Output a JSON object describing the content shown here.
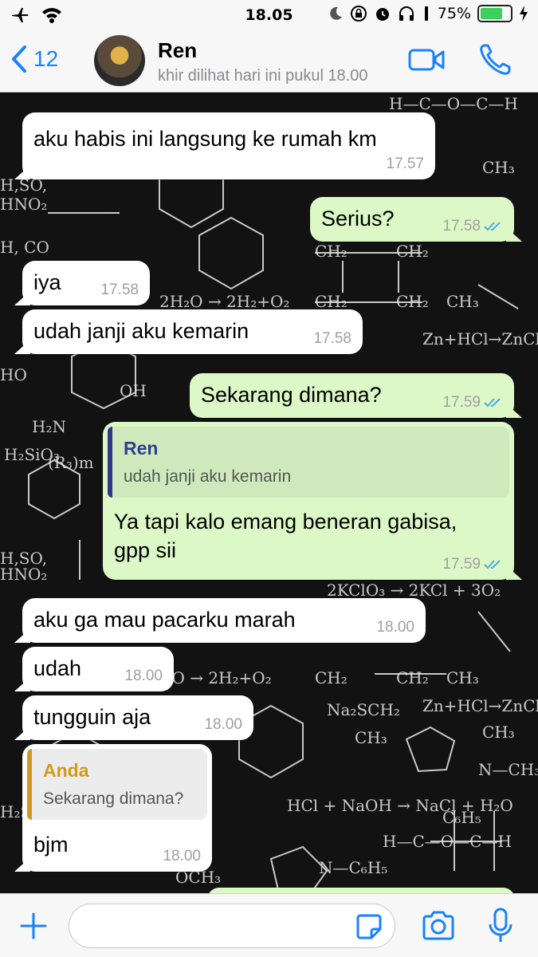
{
  "status_bar": {
    "time": "18.05",
    "battery_percent": "75%",
    "battery_level": 0.75
  },
  "header": {
    "back_count": "12",
    "contact_name": "Ren",
    "contact_status": "khir dilihat hari ini pukul 18.00"
  },
  "messages": [
    {
      "text": "aku habis ini langsung ke rumah km",
      "time": "17.57"
    },
    {
      "text": "Serius?",
      "time": "17.58"
    },
    {
      "text": "iya",
      "time": "17.58"
    },
    {
      "text": "udah janji aku kemarin",
      "time": "17.58"
    },
    {
      "text": "Sekarang dimana?",
      "time": "17.59"
    },
    {
      "quote_name": "Ren",
      "quote_text": "udah janji aku kemarin",
      "text_line1": "Ya tapi kalo emang beneran gabisa,",
      "text_line2": "gpp sii",
      "time": "17.59"
    },
    {
      "text": "aku ga mau pacarku marah",
      "time": "18.00"
    },
    {
      "text": "udah",
      "time": "18.00"
    },
    {
      "text": "tungguin aja",
      "time": "18.00"
    },
    {
      "quote_name": "Anda",
      "quote_text": "Sekarang dimana?",
      "text": "bjm",
      "time": "18.00"
    }
  ],
  "colors": {
    "accent": "#1a82fb",
    "outgoing_bubble": "#dcf8c6",
    "incoming_bubble": "#ffffff",
    "read_tick": "#4fa9e6"
  },
  "icons": [
    "airplane-icon",
    "wifi-icon",
    "moon-icon",
    "rotation-lock-icon",
    "alarm-icon",
    "headphones-icon",
    "signal-icon",
    "battery-icon",
    "charging-icon",
    "back-chevron-icon",
    "video-call-icon",
    "phone-icon",
    "plus-icon",
    "sticker-icon",
    "camera-icon",
    "microphone-icon"
  ]
}
